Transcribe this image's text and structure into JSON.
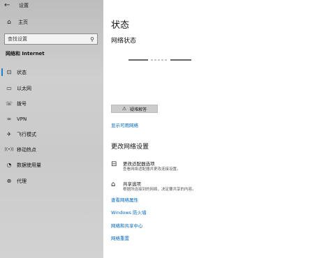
{
  "window": {
    "title": "设置",
    "back_icon": "←",
    "minimize": "—",
    "maximize": "☐",
    "close": "✕"
  },
  "sidebar": {
    "home_label": "主页",
    "search_placeholder": "查找设置",
    "section_title": "网络和 Internet",
    "items": [
      {
        "label": "状态",
        "icon": "⊡"
      },
      {
        "label": "以太网",
        "icon": "▭"
      },
      {
        "label": "拨号",
        "icon": "☏"
      },
      {
        "label": "VPN",
        "icon": "∞"
      },
      {
        "label": "飞行模式",
        "icon": "✈"
      },
      {
        "label": "移动热点",
        "icon": "((•))"
      },
      {
        "label": "数据使用量",
        "icon": "◔"
      },
      {
        "label": "代理",
        "icon": "⊕"
      }
    ],
    "active_index": 0,
    "accent_color": "#1f7fc8"
  },
  "main": {
    "title": "状态",
    "network_status_heading": "网络状态",
    "troubleshoot_label": "疑难解答",
    "show_networks_link": "显示可用网络",
    "change_settings_heading": "更改网络设置",
    "options": [
      {
        "title": "更改适配器选项",
        "desc": "查看网络适配器并更改连接设置。",
        "icon": "⊟"
      },
      {
        "title": "共享选项",
        "desc": "根据所连接到的网络，决定要共享的内容。",
        "icon": "⌂"
      }
    ],
    "links": [
      "查看网络属性",
      "Windows 防火墙",
      "网络和共享中心",
      "网络重置"
    ],
    "link_color": "#0067c0"
  }
}
